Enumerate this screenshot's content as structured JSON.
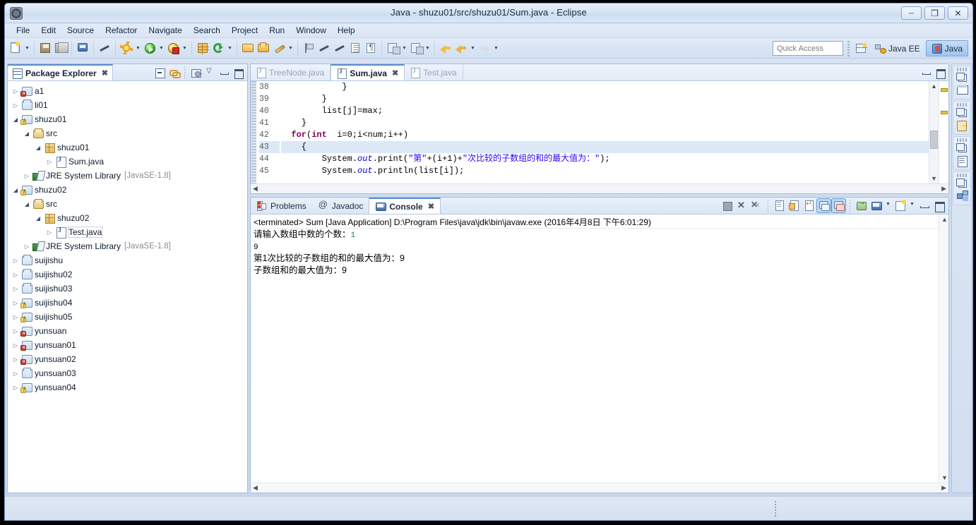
{
  "window": {
    "title": "Java - shuzu01/src/shuzu01/Sum.java - Eclipse",
    "app_icon": "eclipse-icon",
    "controls": {
      "minimize": "–",
      "restore": "❐",
      "close": "✕"
    }
  },
  "menubar": {
    "items": [
      "File",
      "Edit",
      "Source",
      "Refactor",
      "Navigate",
      "Search",
      "Project",
      "Run",
      "Window",
      "Help"
    ]
  },
  "toolbar": {
    "icons": [
      "new-wizard-icon",
      "save-icon",
      "save-all-icon",
      "print-icon",
      "toggle-mark-occurrences-icon",
      "debug-icon",
      "run-icon",
      "run-last-tool-icon",
      "new-java-package-icon",
      "refresh-icon",
      "open-type-icon",
      "search-icon",
      "quick-fix-icon",
      "toggle-breakpoint-icon",
      "pencil-icon",
      "skip-breakpoints-icon",
      "open-task-icon",
      "open-editor-icon",
      "extract-icon",
      "new-annotation-icon",
      "back-icon",
      "previous-icon",
      "forward-icon"
    ],
    "quick_access_placeholder": "Quick Access",
    "open-perspective-icon": "open-perspective-icon",
    "perspectives": [
      {
        "label": "Java EE",
        "icon": "java-ee-perspective-icon",
        "active": false
      },
      {
        "label": "Java",
        "icon": "java-perspective-icon",
        "active": true
      }
    ]
  },
  "package_explorer": {
    "tab_label": "Package Explorer",
    "tab_icon": "package-explorer-icon",
    "close_glyph": "✖",
    "tools": [
      "collapse-all-icon",
      "link-with-editor-icon",
      "view-menu-icon",
      "view-dropdown-icon",
      "minimize-icon",
      "maximize-icon"
    ],
    "tree": [
      {
        "label": "a1",
        "indent": 0,
        "arrow": "closed",
        "icon": "java-project-error-icon",
        "suffix": ""
      },
      {
        "label": "li01",
        "indent": 0,
        "arrow": "closed",
        "icon": "java-project-icon",
        "suffix": ""
      },
      {
        "label": "shuzu01",
        "indent": 0,
        "arrow": "open",
        "icon": "java-project-warn-icon",
        "suffix": ""
      },
      {
        "label": "src",
        "indent": 1,
        "arrow": "open",
        "icon": "source-folder-icon",
        "suffix": ""
      },
      {
        "label": "shuzu01",
        "indent": 2,
        "arrow": "open",
        "icon": "package-icon",
        "suffix": ""
      },
      {
        "label": "Sum.java",
        "indent": 3,
        "arrow": "closed",
        "icon": "java-file-icon",
        "suffix": ""
      },
      {
        "label": "JRE System Library",
        "indent": 1,
        "arrow": "closed",
        "icon": "jre-library-icon",
        "suffix": "[JavaSE-1.8]"
      },
      {
        "label": "shuzu02",
        "indent": 0,
        "arrow": "open",
        "icon": "java-project-warn-icon",
        "suffix": ""
      },
      {
        "label": "src",
        "indent": 1,
        "arrow": "open",
        "icon": "source-folder-icon",
        "suffix": ""
      },
      {
        "label": "shuzu02",
        "indent": 2,
        "arrow": "open",
        "icon": "package-icon",
        "suffix": ""
      },
      {
        "label": "Test.java",
        "indent": 3,
        "arrow": "closed",
        "icon": "java-file-icon",
        "suffix": "",
        "selected": true
      },
      {
        "label": "JRE System Library",
        "indent": 1,
        "arrow": "closed",
        "icon": "jre-library-icon",
        "suffix": "[JavaSE-1.8]"
      },
      {
        "label": "suijishu",
        "indent": 0,
        "arrow": "closed",
        "icon": "java-project-icon",
        "suffix": ""
      },
      {
        "label": "suijishu02",
        "indent": 0,
        "arrow": "closed",
        "icon": "java-project-icon",
        "suffix": ""
      },
      {
        "label": "suijishu03",
        "indent": 0,
        "arrow": "closed",
        "icon": "java-project-icon",
        "suffix": ""
      },
      {
        "label": "suijishu04",
        "indent": 0,
        "arrow": "closed",
        "icon": "java-project-warn-icon",
        "suffix": ""
      },
      {
        "label": "suijishu05",
        "indent": 0,
        "arrow": "closed",
        "icon": "java-project-warn-icon",
        "suffix": ""
      },
      {
        "label": "yunsuan",
        "indent": 0,
        "arrow": "closed",
        "icon": "java-project-error-icon",
        "suffix": ""
      },
      {
        "label": "yunsuan01",
        "indent": 0,
        "arrow": "closed",
        "icon": "java-project-error-icon",
        "suffix": ""
      },
      {
        "label": "yunsuan02",
        "indent": 0,
        "arrow": "closed",
        "icon": "java-project-error-icon",
        "suffix": ""
      },
      {
        "label": "yunsuan03",
        "indent": 0,
        "arrow": "closed",
        "icon": "java-project-icon",
        "suffix": ""
      },
      {
        "label": "yunsuan04",
        "indent": 0,
        "arrow": "closed",
        "icon": "java-project-warn-icon",
        "suffix": ""
      }
    ]
  },
  "editor": {
    "tabs": [
      {
        "label": "TreeNode.java",
        "active": false,
        "closeable": false
      },
      {
        "label": "Sum.java",
        "active": true,
        "closeable": true,
        "close_glyph": "✖"
      },
      {
        "label": "Test.java",
        "active": false,
        "closeable": false
      }
    ],
    "tools": [
      "minimize-icon",
      "maximize-icon"
    ],
    "first_line_number": 38,
    "highlighted_line": 43,
    "lines": [
      {
        "no": 38,
        "text": "            }"
      },
      {
        "no": 39,
        "text": "        }"
      },
      {
        "no": 40,
        "text": "        list[j]=max;"
      },
      {
        "no": 41,
        "text": "    }"
      },
      {
        "no": 42,
        "text": "  for(int  i=0;i<num;i++)"
      },
      {
        "no": 43,
        "text": "    {"
      },
      {
        "no": 44,
        "text": "        System.out.print(\"第\"+(i+1)+\"次比较的子数组的和的最大值为：\");"
      },
      {
        "no": 45,
        "text": "        System.out.println(list[i]);"
      }
    ]
  },
  "console": {
    "tabs": [
      {
        "label": "Problems",
        "icon": "problems-icon",
        "active": false
      },
      {
        "label": "Javadoc",
        "icon": "javadoc-icon",
        "active": false
      },
      {
        "label": "Console",
        "icon": "console-icon",
        "active": true,
        "close_glyph": "✖"
      }
    ],
    "tools": [
      "terminate-icon",
      "remove-launch-icon",
      "remove-all-terminated-icon",
      "clear-console-icon",
      "scroll-lock-icon",
      "word-wrap-icon",
      "show-console-on-output-icon",
      "show-console-on-error-icon",
      "pin-console-icon",
      "display-selected-console-icon",
      "display-console-dropdown-icon",
      "open-console-icon",
      "open-console-dropdown-icon",
      "minimize-icon",
      "maximize-icon"
    ],
    "header": "<terminated> Sum [Java Application] D:\\Program Files\\java\\jdk\\bin\\javaw.exe (2016年4月8日 下午6:01:29)",
    "output": [
      {
        "text": "请输入数组中数的个数：",
        "trailing_input": "1"
      },
      {
        "text": "9",
        "mono": true
      },
      {
        "text": "第1次比较的子数组的和的最大值为：9"
      },
      {
        "text": "子数组和的最大值为：9"
      }
    ]
  },
  "fastview_bar": {
    "groups": [
      {
        "restore_icon": "restore-icon",
        "view_icon": "outline-view-icon"
      },
      {
        "restore_icon": "restore-icon",
        "view_icon": "task-repositories-icon"
      },
      {
        "restore_icon": "restore-icon",
        "view_icon": "task-list-icon"
      },
      {
        "restore_icon": "restore-icon",
        "view_icon": "type-hierarchy-icon"
      }
    ]
  },
  "colors": {
    "accent": "#5a8fd0",
    "keyword": "#7f0055",
    "string": "#2a00ff",
    "field": "#0000c0",
    "highlight_line": "#dde8f7",
    "chrome": "#d5e0f0"
  }
}
